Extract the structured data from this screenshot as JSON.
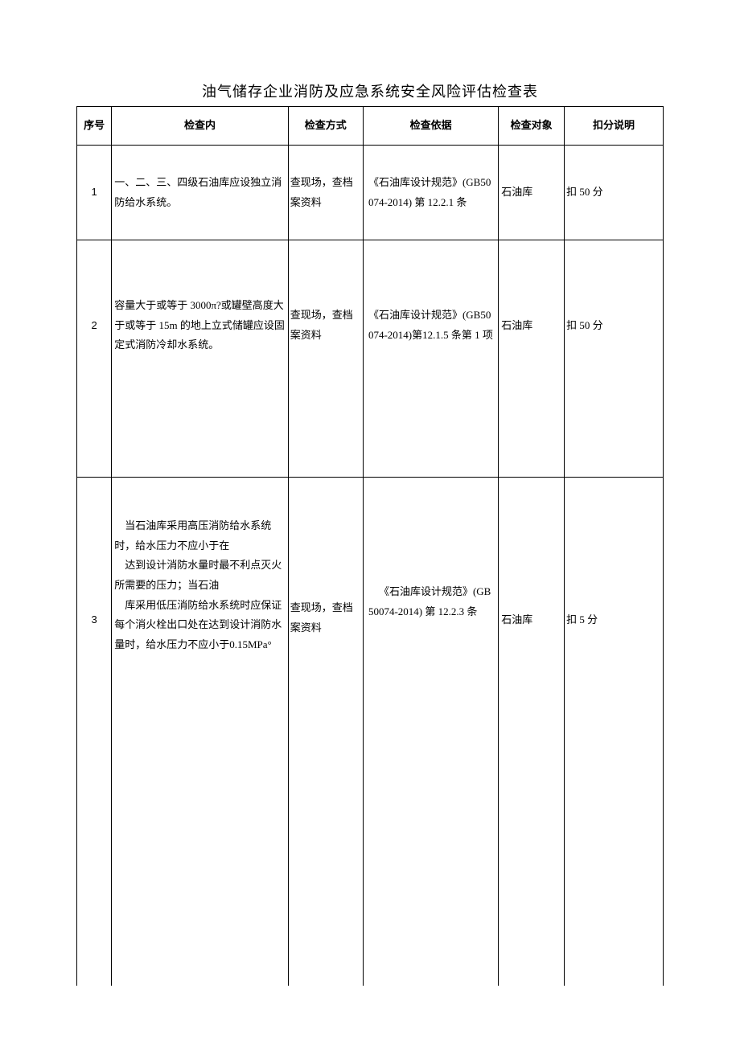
{
  "title": "油气储存企业消防及应急系统安全风险评估检查表",
  "headers": {
    "seq": "序号",
    "content": "检查内",
    "method": "检查方式",
    "basis": "检查依据",
    "object": "检查对象",
    "deduct": "扣分说明"
  },
  "rows": [
    {
      "seq": "1",
      "content": "一、二、三、四级石油库应设独立消防给水系统。",
      "method": "查现场，查档案资料",
      "basis": "《石油库设计规范》(GB50074-2014) 第 12.2.1 条",
      "object": "石油库",
      "deduct": "扣 50 分"
    },
    {
      "seq": "2",
      "content": "容量大于或等于 3000π?或罐壁高度大于或等于 15m 的地上立式储罐应设固定式消防冷却水系统。",
      "method": "查现场，查档案资料",
      "basis": "《石油库设计规范》(GB50074-2014)第12.1.5 条第 1 项",
      "object": "石油库",
      "deduct": "扣 50 分"
    },
    {
      "seq": "3",
      "content_p1": "当石油库采用高压消防给水系统时，给水压力不应小于在",
      "content_p2": "达到设计消防水量时最不利点灭火所需要的压力；当石油",
      "content_p3": "库采用低压消防给水系统时应保证每个消火栓出口处在达到设计消防水量时，给水压力不应小于0.15MPa°",
      "method": "查现场，查档案资料",
      "basis": "《石油库设计规范》(GB50074-2014) 第 12.2.3 条",
      "object": "石油库",
      "deduct": "扣 5 分"
    }
  ]
}
